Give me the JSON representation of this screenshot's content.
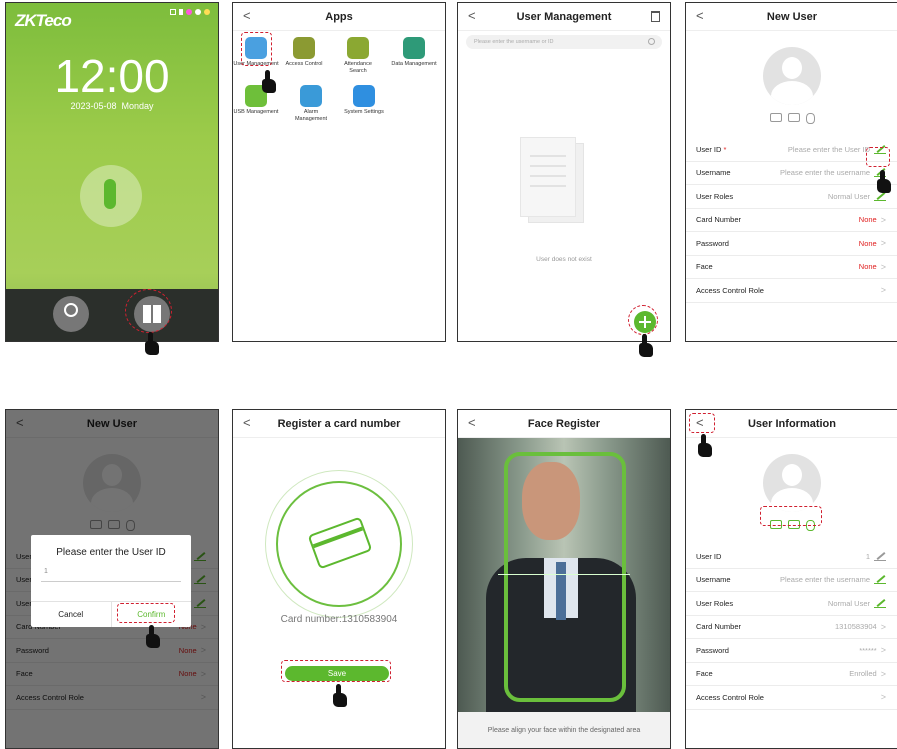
{
  "lock": {
    "logo": "ZKTeco",
    "time": "12:00",
    "date": "2023-05-08",
    "weekday": "Monday"
  },
  "apps": {
    "title": "Apps",
    "back": "<",
    "items": [
      "User Management",
      "Access Control",
      "Attendance Search",
      "Data Management",
      "USB Management",
      "Alarm Management",
      "System Settings"
    ]
  },
  "um": {
    "title": "User Management",
    "back": "<",
    "search_placeholder": "Please enter the username or ID",
    "empty": "User does not exist"
  },
  "nu": {
    "title": "New User",
    "back": "<",
    "rows": [
      {
        "label": "User ID",
        "value": "Please enter the User ID"
      },
      {
        "label": "Username",
        "value": "Please enter the username"
      },
      {
        "label": "User Roles",
        "value": "Normal User"
      },
      {
        "label": "Card Number",
        "value": "None"
      },
      {
        "label": "Password",
        "value": "None"
      },
      {
        "label": "Face",
        "value": "None"
      },
      {
        "label": "Access Control Role",
        "value": ""
      }
    ]
  },
  "dialog": {
    "title": "Please enter the User ID",
    "value": "1",
    "cancel": "Cancel",
    "confirm": "Confirm"
  },
  "card": {
    "title": "Register a card number",
    "back": "<",
    "number": "Card number:1310583904",
    "save": "Save"
  },
  "face": {
    "title": "Face Register",
    "back": "<",
    "hint": "Please align your face within the designated area"
  },
  "ui": {
    "title": "User Information",
    "back": "<",
    "rows": [
      {
        "label": "User ID",
        "value": "1"
      },
      {
        "label": "Username",
        "value": "Please enter the username"
      },
      {
        "label": "User Roles",
        "value": "Normal User"
      },
      {
        "label": "Card Number",
        "value": "1310583904"
      },
      {
        "label": "Password",
        "value": "******"
      },
      {
        "label": "Face",
        "value": "Enrolled"
      },
      {
        "label": "Access Control Role",
        "value": ""
      }
    ]
  },
  "colors": {
    "accent": "#5cb82e",
    "required": "#e02020",
    "highlight": "#d02030"
  }
}
